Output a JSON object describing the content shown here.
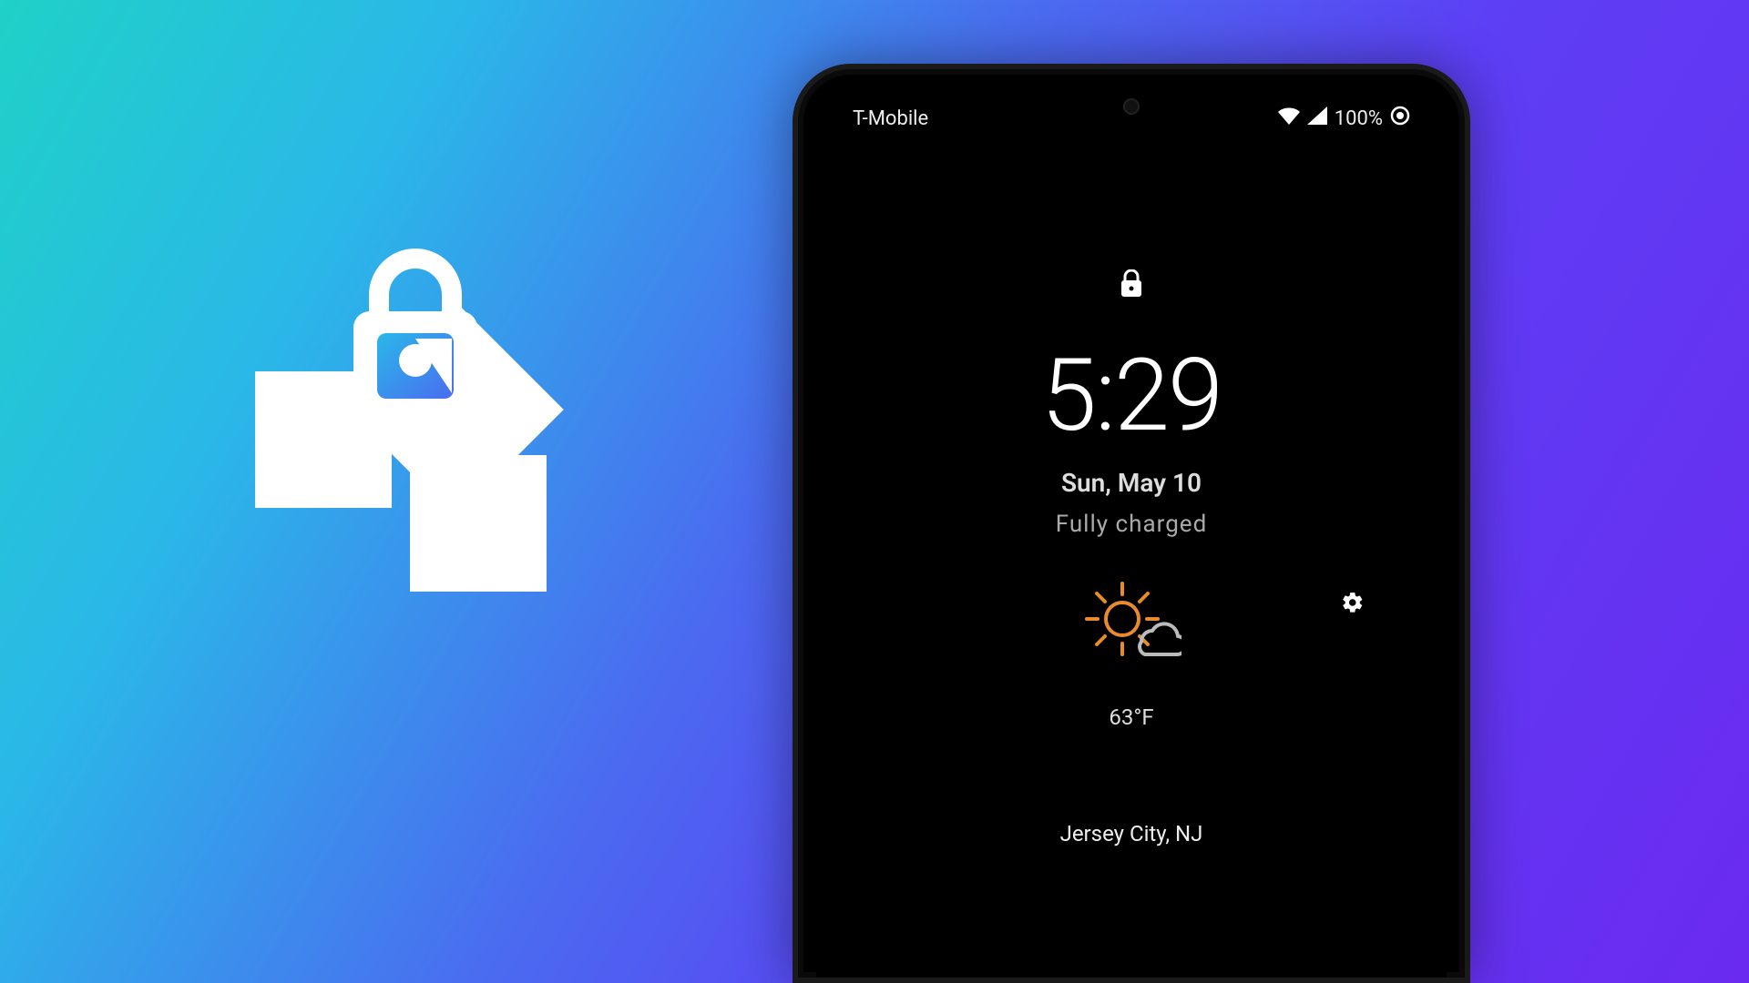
{
  "status_bar": {
    "carrier": "T-Mobile",
    "battery_text": "100%"
  },
  "lockscreen": {
    "time": "5:29",
    "date": "Sun, May 10",
    "charge_status": "Fully charged",
    "temperature": "63°F",
    "location": "Jersey City, NJ"
  }
}
